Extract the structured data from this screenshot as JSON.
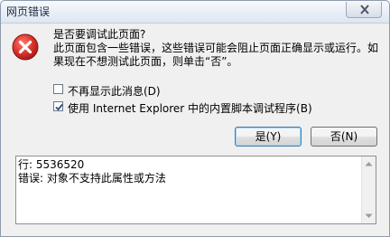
{
  "window": {
    "title": "网页错误"
  },
  "icons": {
    "close": "close-icon",
    "error": "error-icon"
  },
  "message": {
    "lines": [
      "是否要调试此页面?",
      "此页面包含一些错误，这些错误可能会阻止页面正确显示或运行。如",
      "果现在不想测试此页面，则单击“否”。"
    ]
  },
  "options": {
    "dont_show": {
      "label": "不再显示此消息(D)",
      "checked": false
    },
    "use_debugger": {
      "label": "使用 Internet Explorer 中的内置脚本调试程序(B)",
      "checked": true
    }
  },
  "buttons": {
    "yes": "是(Y)",
    "no": "否(N)"
  },
  "details": {
    "line": "行: 5536520",
    "error": "错误: 对象不支持此属性或方法"
  },
  "colors": {
    "error_red": "#d9302a",
    "accent_border": "#3c7fb1"
  }
}
